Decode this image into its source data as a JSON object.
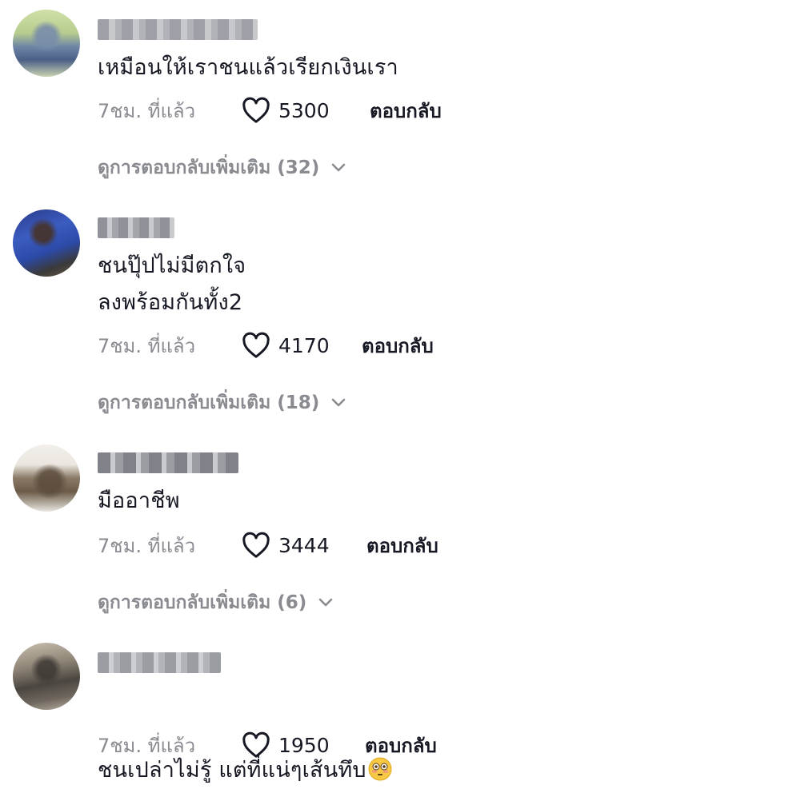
{
  "comments": [
    {
      "text": "เหมือนให้เราชนแล้วเรียกเงินเรา",
      "time": "7ชม. ที่แล้ว",
      "likes": "5300",
      "reply": "ตอบกลับ",
      "more_replies": "ดูการตอบกลับเพิ่มเติม (32)"
    },
    {
      "text": "ชนปุ๊ปไม่มีตกใจ\nลงพร้อมกันทั้ง2",
      "time": "7ชม. ที่แล้ว",
      "likes": "4170",
      "reply": "ตอบกลับ",
      "more_replies": "ดูการตอบกลับเพิ่มเติม (18)"
    },
    {
      "text": "มืออาชีพ",
      "time": "7ชม. ที่แล้ว",
      "likes": "3444",
      "reply": "ตอบกลับ",
      "more_replies": "ดูการตอบกลับเพิ่มเติม (6)"
    },
    {
      "text": "ชนเปล่าไม่รู้ แต่ที่แน่ๆเส้นทึบ",
      "emoji": "flushed-face",
      "time": "7ชม. ที่แล้ว",
      "likes": "1950",
      "reply": "ตอบกลับ"
    }
  ],
  "icons": {
    "like": "heart-outline-icon",
    "expand": "chevron-down-icon"
  },
  "colors": {
    "text": "#161823",
    "secondary": "#8a8b91",
    "background": "#ffffff"
  }
}
